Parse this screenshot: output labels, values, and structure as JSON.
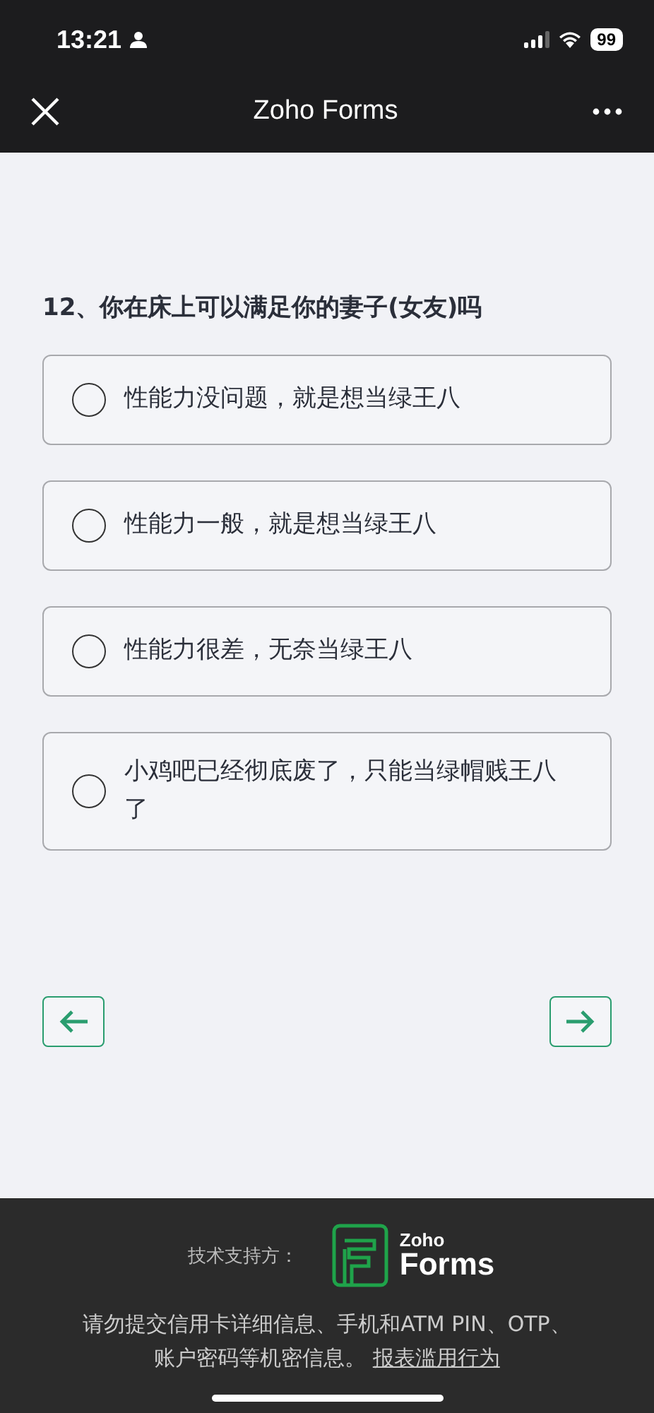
{
  "status_bar": {
    "time": "13:21",
    "battery": "99"
  },
  "nav_bar": {
    "title": "Zoho Forms"
  },
  "question": {
    "title": "12、你在床上可以满足你的妻子(女友)吗",
    "options": [
      {
        "label": "性能力没问题，就是想当绿王八",
        "selected": false
      },
      {
        "label": "性能力一般，就是想当绿王八",
        "selected": false
      },
      {
        "label": "性能力很差，无奈当绿王八",
        "selected": false
      },
      {
        "label": "小鸡吧已经彻底废了，只能当绿帽贱王八了",
        "selected": false
      }
    ]
  },
  "footer": {
    "powered_by": "技术支持方：",
    "logo_top": "Zoho",
    "logo_bottom": "Forms",
    "notice": "请勿提交信用卡详细信息、手机和ATM PIN、OTP、账户密码等机密信息。",
    "report_link": "报表滥用行为"
  }
}
